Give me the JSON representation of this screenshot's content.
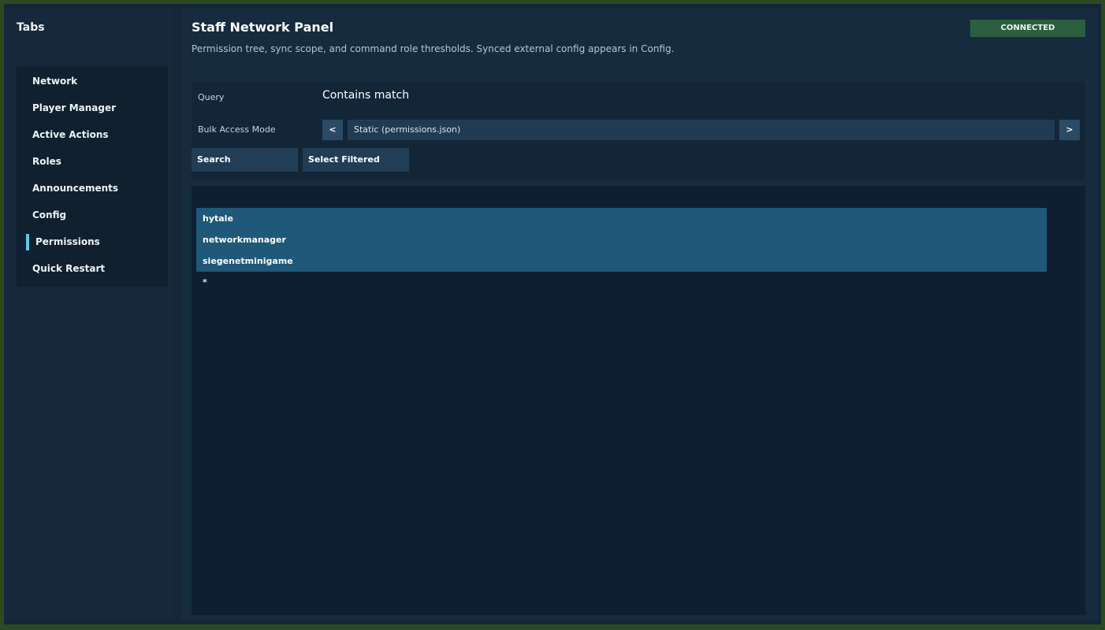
{
  "sidebar": {
    "title": "Tabs",
    "items": [
      {
        "label": "Network"
      },
      {
        "label": "Player Manager"
      },
      {
        "label": "Active Actions"
      },
      {
        "label": "Roles"
      },
      {
        "label": "Announcements"
      },
      {
        "label": "Config"
      },
      {
        "label": "Permissions",
        "active": true
      },
      {
        "label": "Quick Restart"
      }
    ]
  },
  "header": {
    "title": "Staff Network Panel",
    "subtitle": "Permission tree, sync scope, and command role thresholds. Synced external config appears in Config.",
    "status": "CONNECTED"
  },
  "query": {
    "label": "Query",
    "value": "Contains match"
  },
  "bulk_mode": {
    "label": "Bulk Access Mode",
    "prev_label": "<",
    "value": "Static (permissions.json)",
    "next_label": ">"
  },
  "actions": {
    "search_label": "Search",
    "select_filtered_label": "Select Filtered"
  },
  "permissions": {
    "items": [
      {
        "label": "hytale",
        "selected": true
      },
      {
        "label": "networkmanager",
        "selected": true
      },
      {
        "label": "siegenetminigame",
        "selected": true
      },
      {
        "label": "*",
        "selected": false
      }
    ]
  },
  "colors": {
    "accent": "#5cc7f0",
    "status_bg": "#2b5f3f",
    "selection": "#1f5878",
    "background": "#142637"
  }
}
